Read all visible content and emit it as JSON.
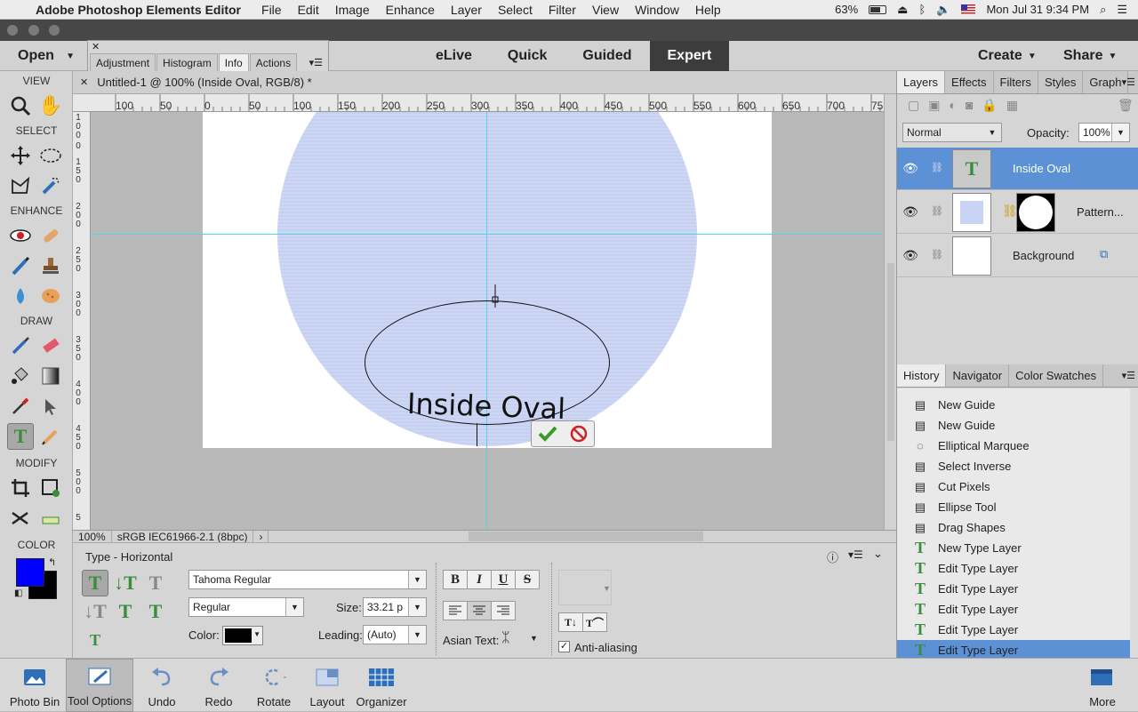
{
  "menubar": {
    "app_name": "Adobe Photoshop Elements Editor",
    "items": [
      "File",
      "Edit",
      "Image",
      "Enhance",
      "Layer",
      "Select",
      "Filter",
      "View",
      "Window",
      "Help"
    ],
    "battery": "63%",
    "clock": "Mon Jul 31  9:34 PM"
  },
  "toolbar": {
    "open_label": "Open",
    "modes": [
      "eLive",
      "Quick",
      "Guided",
      "Expert"
    ],
    "active_mode": "Expert",
    "create_label": "Create",
    "share_label": "Share"
  },
  "float_panel": {
    "tabs": [
      "Adjustment",
      "Histogram",
      "Info",
      "Actions"
    ],
    "active_tab": "Info"
  },
  "tool_panel": {
    "sections": [
      "VIEW",
      "SELECT",
      "ENHANCE",
      "DRAW",
      "MODIFY",
      "COLOR"
    ]
  },
  "document": {
    "tab_title": "Untitled-1 @ 100% (Inside Oval, RGB/8) *",
    "ruler_h": [
      "100",
      "50",
      "0",
      "50",
      "100",
      "150",
      "200",
      "250",
      "300",
      "350",
      "400",
      "450",
      "500",
      "550",
      "600",
      "650",
      "700",
      "75"
    ],
    "ruler_v": [
      "1\n0\n0",
      "0",
      "1\n5\n0",
      "2\n0\n0",
      "2\n5\n0",
      "3\n0\n0",
      "3\n5\n0",
      "4\n0\n0",
      "4\n5\n0",
      "5\n0\n0",
      "5"
    ],
    "type_text": "Inside Oval",
    "zoom": "100%",
    "profile": "sRGB IEC61966-2.1 (8bpc)"
  },
  "tool_options": {
    "title": "Type - Horizontal",
    "font_family": "Tahoma Regular",
    "font_style": "Regular",
    "size_label": "Size:",
    "size_value": "33.21 p",
    "color_label": "Color:",
    "leading_label": "Leading:",
    "leading_value": "(Auto)",
    "bold": "B",
    "italic": "I",
    "underline": "U",
    "strike": "S",
    "asian_text_label": "Asian Text:",
    "anti_aliasing_label": "Anti-aliasing",
    "anti_aliasing_checked": true
  },
  "layers_panel": {
    "tabs": [
      "Layers",
      "Effects",
      "Filters",
      "Styles",
      "Graph"
    ],
    "active_tab": "Layers",
    "blend_mode": "Normal",
    "opacity_label": "Opacity:",
    "opacity_value": "100%",
    "layers": [
      {
        "name": "Inside Oval",
        "selected": true
      },
      {
        "name": "Pattern...",
        "selected": false
      },
      {
        "name": "Background",
        "selected": false
      }
    ]
  },
  "history_panel": {
    "tabs": [
      "History",
      "Navigator",
      "Color Swatches"
    ],
    "active_tab": "History",
    "items": [
      "New Guide",
      "New Guide",
      "Elliptical Marquee",
      "Select Inverse",
      "Cut Pixels",
      "Ellipse Tool",
      "Drag Shapes",
      "New Type Layer",
      "Edit Type Layer",
      "Edit Type Layer",
      "Edit Type Layer",
      "Edit Type Layer",
      "Edit Type Layer"
    ],
    "selected_index": 12
  },
  "bottom_bar": {
    "buttons": [
      "Photo Bin",
      "Tool Options",
      "Undo",
      "Redo",
      "Rotate",
      "Layout",
      "Organizer"
    ],
    "more_label": "More"
  },
  "colors": {
    "foreground": "#0000ff",
    "background": "#000000",
    "selection": "#5c91d6",
    "guide": "#55d6e6"
  }
}
